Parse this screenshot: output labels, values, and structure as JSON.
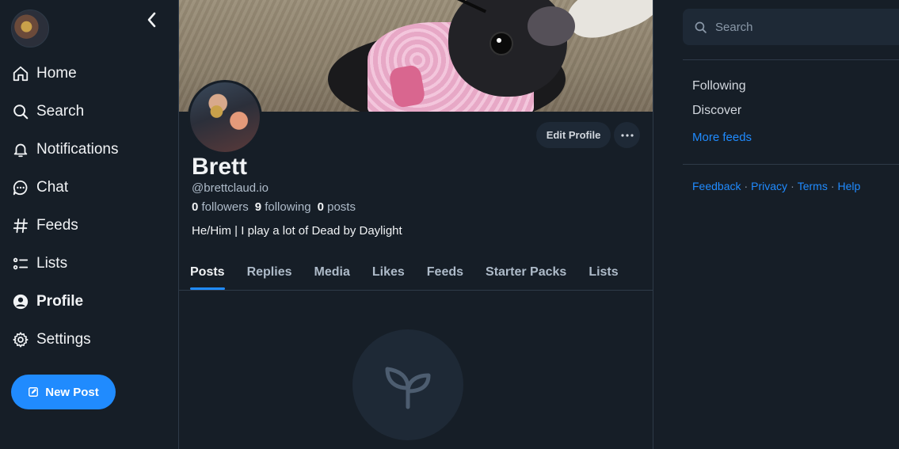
{
  "nav": {
    "items": [
      {
        "label": "Home",
        "icon": "home-icon"
      },
      {
        "label": "Search",
        "icon": "search-icon"
      },
      {
        "label": "Notifications",
        "icon": "bell-icon"
      },
      {
        "label": "Chat",
        "icon": "chat-icon"
      },
      {
        "label": "Feeds",
        "icon": "hash-icon"
      },
      {
        "label": "Lists",
        "icon": "list-icon"
      },
      {
        "label": "Profile",
        "icon": "person-icon"
      },
      {
        "label": "Settings",
        "icon": "gear-icon"
      }
    ],
    "active": "Profile",
    "new_post_label": "New Post"
  },
  "profile": {
    "display_name": "Brett",
    "handle": "@brettclaud.io",
    "followers_count": "0",
    "followers_label": "followers",
    "following_count": "9",
    "following_label": "following",
    "posts_count": "0",
    "posts_label": "posts",
    "bio": "He/Him | I play a lot of Dead by Daylight",
    "edit_label": "Edit Profile"
  },
  "tabs": [
    "Posts",
    "Replies",
    "Media",
    "Likes",
    "Feeds",
    "Starter Packs",
    "Lists"
  ],
  "active_tab": "Posts",
  "right": {
    "search_placeholder": "Search",
    "feeds": [
      "Following",
      "Discover"
    ],
    "more_feeds": "More feeds",
    "footer": [
      "Feedback",
      "Privacy",
      "Terms",
      "Help"
    ]
  },
  "colors": {
    "background": "#161e27",
    "accent": "#208bfe",
    "surface": "#1e2936",
    "border": "#2e3a48",
    "muted_text": "#aebbc9"
  }
}
